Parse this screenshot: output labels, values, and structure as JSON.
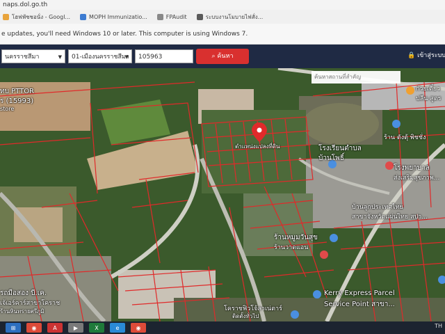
{
  "browser": {
    "url": "naps.dol.go.th",
    "bookmarks": [
      {
        "label": "โฮฟพัชชอนั่ง - Googl...",
        "color": "#e8a33b"
      },
      {
        "label": "MOPH Immunizatio...",
        "color": "#3c7bd1"
      },
      {
        "label": "FPAudit",
        "color": "#888888"
      },
      {
        "label": "ระบบงานโมบายไฟสั่ง...",
        "color": "#5a5a5a"
      }
    ],
    "notice": "e updates, you'll need Windows 10 or later. This computer is using Windows 7."
  },
  "toolbar": {
    "province": "นครราชสีมา",
    "district": "01-เมืองนครราชสีมา",
    "parcel_no": "105963",
    "search_label": "ค้นหา",
    "login_label": "เข้าสู่ระบบ"
  },
  "map": {
    "search_placeholder": "ค้นหาสถานที่สำคัญ",
    "labels": {
      "pttor": "ทบ PTTOR",
      "pttor_sub": "ร (15993)",
      "store": "store",
      "parcel": "ตำแหน่งแปลงที่ดิน",
      "school1": "โรงเรียนตำบล",
      "school2": "บ้านโพธิ์",
      "shop": "ร้าน ตังตุ้ พิชชั่ง",
      "hospital1": "โรงพยาบาล",
      "hospital2": "ส่งเสริมสุขภาพ...",
      "coop1": "บ้านลูกประเทศไทย",
      "coop2": "สาขาจังหวัดแผ่นไทย สปา...",
      "market": "ร้านหมูมวันสุข",
      "market2": "ร้านวาดแอน",
      "kerry1": "Kerry Express Parcel",
      "kerry2": "Service Point สาขา...",
      "left_bottom1": "รถมือสอง บี.เค.",
      "left_bottom2": "เจ้เอร์คาร์สาขาโคราช",
      "left_bottom3": "ร้านหินทรายศรีภูมิ",
      "bottom_mid1": "โคราชฟิวโจ้ลาเน่ตาร์",
      "bottom_mid2": "ติดตั้งทั่วไป",
      "top_right1": "ก๋วยเตี๋ยว",
      "top_right2": "ปลีน สูตร"
    }
  },
  "taskbar": {
    "items": [
      {
        "icon": "windows-start-icon",
        "color": "#2d6fbf",
        "glyph": "⊞"
      },
      {
        "icon": "chrome-icon",
        "color": "#dd4b39",
        "glyph": "◉"
      },
      {
        "icon": "pdf-icon",
        "color": "#c33",
        "glyph": "A"
      },
      {
        "icon": "media-icon",
        "color": "#7a7a7a",
        "glyph": "▶"
      },
      {
        "icon": "excel-icon",
        "color": "#1f7a3a",
        "glyph": "X"
      },
      {
        "icon": "ie-icon",
        "color": "#2a8ad6",
        "glyph": "e"
      },
      {
        "icon": "chrome-icon-2",
        "color": "#dd4b39",
        "glyph": "◉"
      }
    ],
    "tray": "TH"
  }
}
